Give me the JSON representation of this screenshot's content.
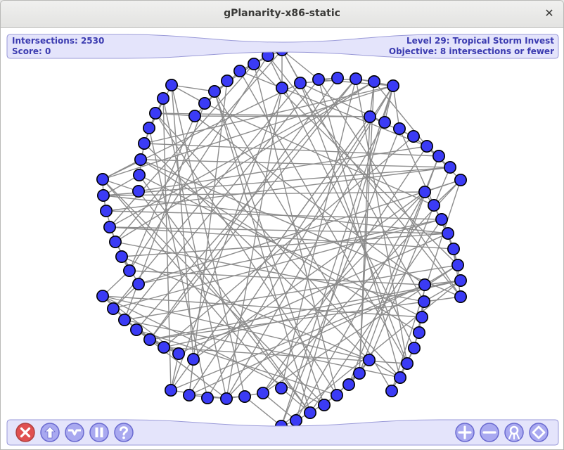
{
  "window": {
    "title": "gPlanarity-x86-static"
  },
  "status": {
    "intersections": "Intersections: 2530",
    "score": "Score: 0",
    "level": "Level 29: Tropical Storm Invest",
    "objective": "Objective: 8 intersections or fewer"
  },
  "toolbar_left": [
    "quit-button",
    "back-button",
    "reset-button",
    "pause-button",
    "help-button"
  ],
  "toolbar_right": [
    "zoom-in-button",
    "zoom-out-button",
    "expand-button",
    "hide-lines-button"
  ],
  "colors": {
    "vertex_fill": "#3b3bf5",
    "vertex_stroke": "#000000",
    "edge": "#8c8c8c",
    "hud_fill": "#e4e4fb",
    "hud_stroke": "#9a9ad8",
    "hud_text": "#3b3bb0",
    "quit_red": "#e05050"
  }
}
